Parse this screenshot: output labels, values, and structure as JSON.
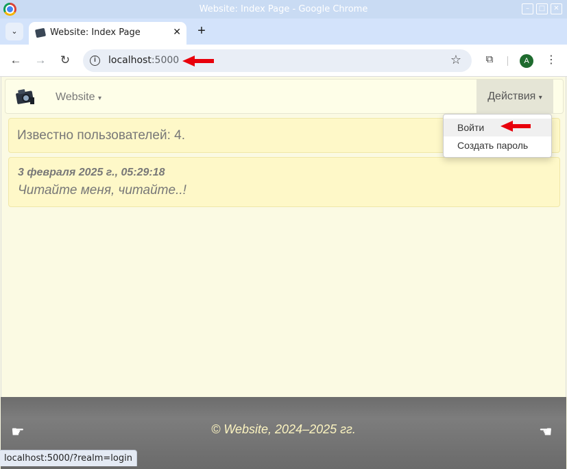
{
  "window": {
    "title": "Website: Index Page - Google Chrome",
    "btn_minimize": "–",
    "btn_maximize": "□",
    "btn_close": "✕"
  },
  "tabs": {
    "search_glyph": "⌄",
    "active_tab_title": "Website: Index Page",
    "close_glyph": "✕",
    "new_tab_glyph": "+"
  },
  "toolbar": {
    "back_glyph": "←",
    "forward_glyph": "→",
    "reload_glyph": "↻",
    "info_glyph": "i",
    "url_host": "localhost",
    "url_port": ":5000",
    "star_glyph": "☆",
    "extensions_glyph": "⧉",
    "avatar_letter": "A",
    "menu_glyph": "⋮"
  },
  "navbar": {
    "brand_menu_label": "Website",
    "actions_menu_label": "Действия",
    "caret": "▾"
  },
  "dropdown": {
    "items": [
      {
        "label": "Войти"
      },
      {
        "label": "Создать пароль"
      }
    ]
  },
  "main": {
    "users_known_text": "Известно пользователей: 4.",
    "post": {
      "date": "3 февраля 2025 г., 05:29:18",
      "text": "Читайте меня, читайте..!"
    }
  },
  "footer": {
    "copyright": "© Website, 2024–2025 гг.",
    "left_hand_glyph": "☛",
    "right_hand_glyph": "☚"
  },
  "status_bar": {
    "hover_url": "localhost:5000/?realm=login"
  },
  "colors": {
    "annotation_arrow": "#e8000b",
    "page_background": "#fbfae3",
    "panel_background": "#fef8c8"
  },
  "icons": {
    "chrome_logo": "chrome-logo-icon",
    "favicon": "camera-icon",
    "brand_logo": "camera-icon"
  }
}
